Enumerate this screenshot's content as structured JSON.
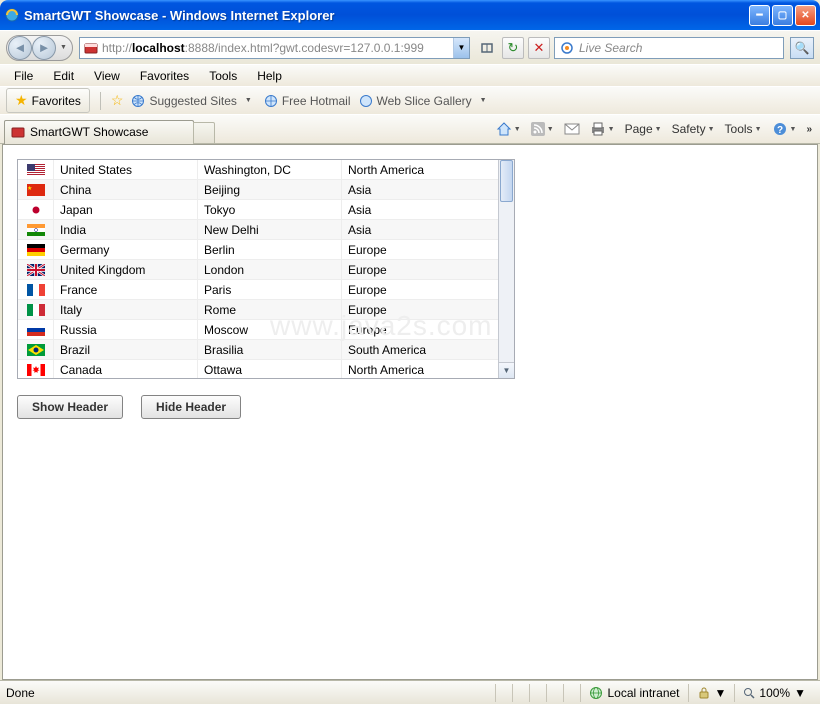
{
  "window": {
    "title": "SmartGWT Showcase - Windows Internet Explorer"
  },
  "address": {
    "prefix": "http://",
    "host": "localhost",
    "rest": ":8888/index.html?gwt.codesvr=127.0.0.1:999"
  },
  "search": {
    "placeholder": "Live Search"
  },
  "menu": {
    "items": [
      "File",
      "Edit",
      "View",
      "Favorites",
      "Tools",
      "Help"
    ]
  },
  "favoritesBar": {
    "button": "Favorites",
    "links": [
      "Suggested Sites",
      "Free Hotmail",
      "Web Slice Gallery"
    ]
  },
  "tab": {
    "title": "SmartGWT Showcase"
  },
  "commandBar": {
    "items": [
      "Page",
      "Safety",
      "Tools"
    ]
  },
  "grid": {
    "rows": [
      {
        "flag": "us",
        "country": "United States",
        "capital": "Washington, DC",
        "continent": "North America"
      },
      {
        "flag": "cn",
        "country": "China",
        "capital": "Beijing",
        "continent": "Asia"
      },
      {
        "flag": "jp",
        "country": "Japan",
        "capital": "Tokyo",
        "continent": "Asia"
      },
      {
        "flag": "in",
        "country": "India",
        "capital": "New Delhi",
        "continent": "Asia"
      },
      {
        "flag": "de",
        "country": "Germany",
        "capital": "Berlin",
        "continent": "Europe"
      },
      {
        "flag": "gb",
        "country": "United Kingdom",
        "capital": "London",
        "continent": "Europe"
      },
      {
        "flag": "fr",
        "country": "France",
        "capital": "Paris",
        "continent": "Europe"
      },
      {
        "flag": "it",
        "country": "Italy",
        "capital": "Rome",
        "continent": "Europe"
      },
      {
        "flag": "ru",
        "country": "Russia",
        "capital": "Moscow",
        "continent": "Europe"
      },
      {
        "flag": "br",
        "country": "Brazil",
        "capital": "Brasilia",
        "continent": "South America"
      },
      {
        "flag": "ca",
        "country": "Canada",
        "capital": "Ottawa",
        "continent": "North America"
      }
    ]
  },
  "buttons": {
    "show": "Show Header",
    "hide": "Hide Header"
  },
  "statusbar": {
    "done": "Done",
    "zone": "Local intranet",
    "zoom": "100%"
  },
  "watermark": "www.java2s.com"
}
